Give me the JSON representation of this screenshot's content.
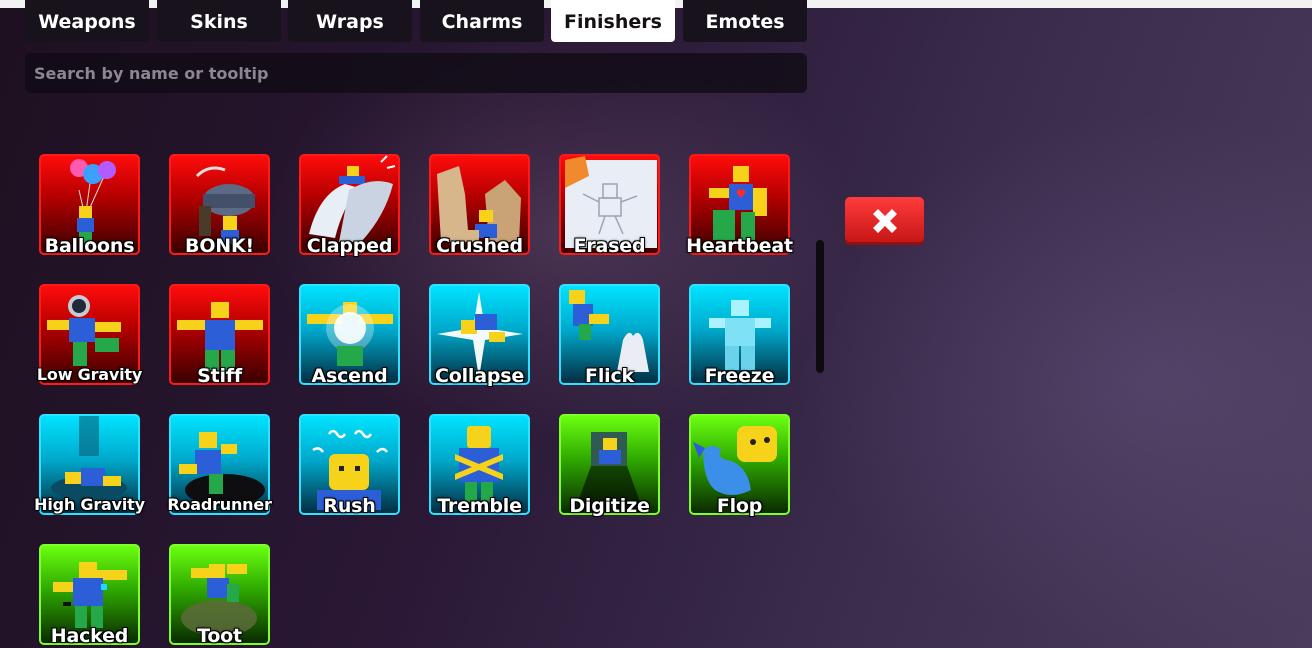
{
  "tabs": [
    {
      "label": "Weapons",
      "active": false
    },
    {
      "label": "Skins",
      "active": false
    },
    {
      "label": "Wraps",
      "active": false
    },
    {
      "label": "Charms",
      "active": false
    },
    {
      "label": "Finishers",
      "active": true
    },
    {
      "label": "Emotes",
      "active": false
    }
  ],
  "search": {
    "placeholder": "Search by name or tooltip"
  },
  "items": [
    {
      "name": "Balloons",
      "rarity": "red",
      "icon": "balloons-icon"
    },
    {
      "name": "BONK!",
      "rarity": "red",
      "icon": "hammer-icon"
    },
    {
      "name": "Clapped",
      "rarity": "red",
      "icon": "clapping-hands-icon"
    },
    {
      "name": "Crushed",
      "rarity": "red",
      "icon": "crushed-rubble-icon"
    },
    {
      "name": "Erased",
      "rarity": "red",
      "icon": "eraser-paper-icon"
    },
    {
      "name": "Heartbeat",
      "rarity": "red",
      "icon": "heart-character-icon"
    },
    {
      "name": "Low Gravity",
      "rarity": "red",
      "icon": "astronaut-icon"
    },
    {
      "name": "Stiff",
      "rarity": "red",
      "icon": "t-pose-icon"
    },
    {
      "name": "Ascend",
      "rarity": "blue",
      "icon": "ascend-light-icon"
    },
    {
      "name": "Collapse",
      "rarity": "blue",
      "icon": "collapse-flash-icon"
    },
    {
      "name": "Flick",
      "rarity": "blue",
      "icon": "finger-flick-icon"
    },
    {
      "name": "Freeze",
      "rarity": "blue",
      "icon": "frozen-character-icon"
    },
    {
      "name": "High Gravity",
      "rarity": "blue",
      "icon": "gravity-crush-icon"
    },
    {
      "name": "Roadrunner",
      "rarity": "blue",
      "icon": "hole-fall-icon"
    },
    {
      "name": "Rush",
      "rarity": "blue",
      "icon": "rush-face-icon"
    },
    {
      "name": "Tremble",
      "rarity": "blue",
      "icon": "tremble-character-icon"
    },
    {
      "name": "Digitize",
      "rarity": "green",
      "icon": "digitize-beam-icon"
    },
    {
      "name": "Flop",
      "rarity": "green",
      "icon": "fish-character-icon"
    },
    {
      "name": "Hacked",
      "rarity": "green",
      "icon": "glitch-character-icon"
    },
    {
      "name": "Toot",
      "rarity": "green",
      "icon": "toot-cloud-icon"
    }
  ],
  "close": {
    "icon": "close-x-icon"
  },
  "colors": {
    "red_rarity": "#e00000",
    "blue_rarity": "#00c8ec",
    "green_rarity": "#4fe000",
    "close_button": "#e02626",
    "active_tab": "#ffffff"
  }
}
